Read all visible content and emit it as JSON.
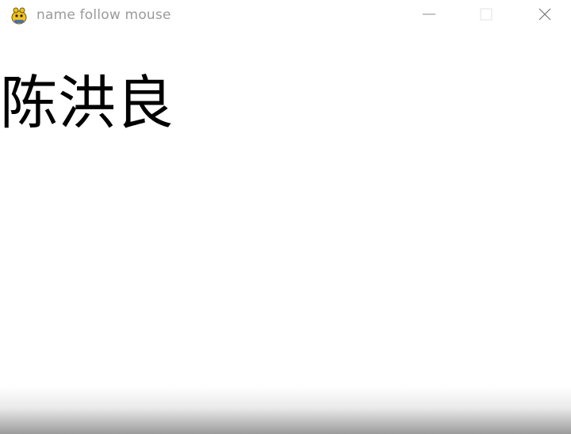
{
  "window": {
    "title": "name follow mouse",
    "icon": "pygame-snake-icon",
    "controls": {
      "minimize": "minimize-icon",
      "maximize": "maximize-icon",
      "close": "close-icon"
    }
  },
  "canvas": {
    "name_text": "陈洪良",
    "background_color": "#ffffff",
    "text_color": "#000000"
  }
}
